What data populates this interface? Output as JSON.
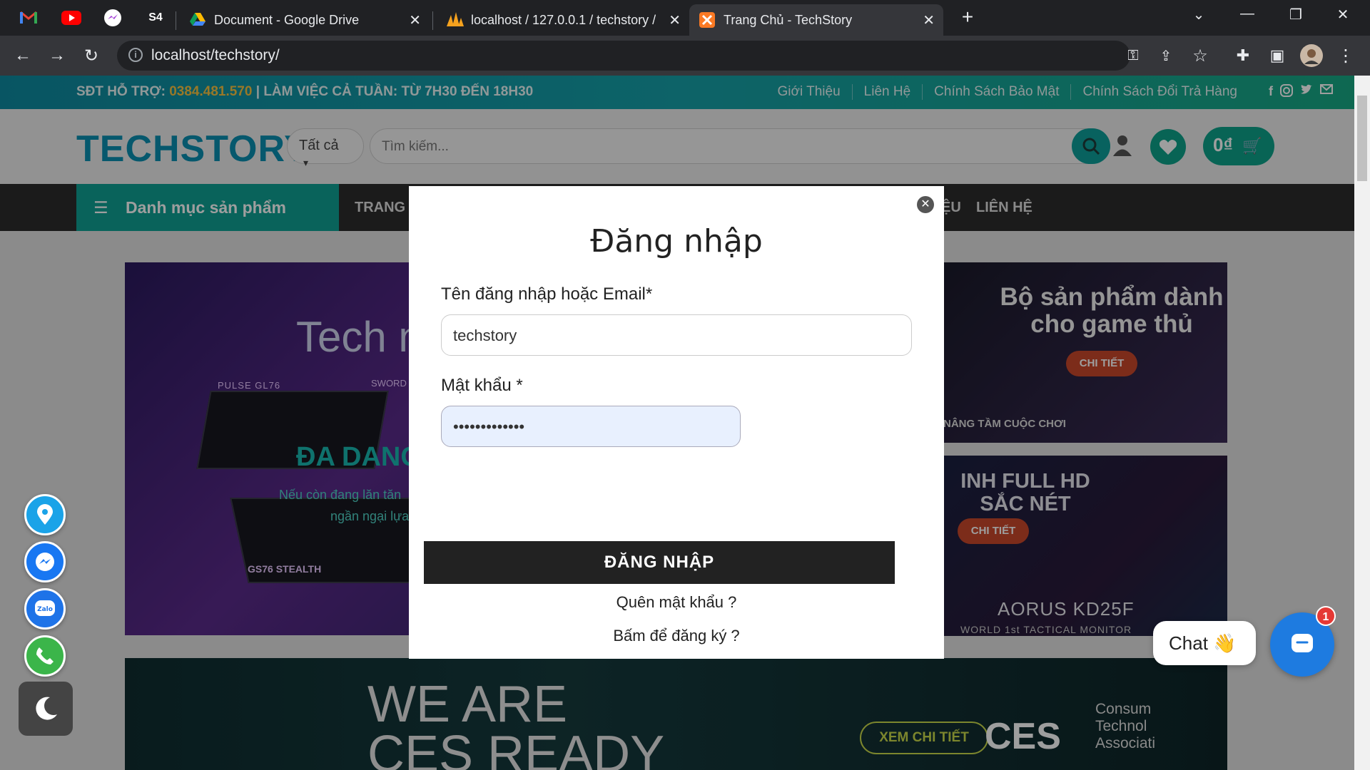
{
  "browser": {
    "pinned_tabs": [
      "gmail-icon",
      "youtube-icon",
      "messenger-icon",
      "s4-icon"
    ],
    "pinned_s4_label": "S4",
    "tabs": [
      {
        "title": "Document - Google Drive"
      },
      {
        "title": "localhost / 127.0.0.1 / techstory /"
      },
      {
        "title": "Trang Chủ - TechStory"
      }
    ],
    "new_tab": "+",
    "url": "localhost/techstory/"
  },
  "topbar": {
    "phone_label": "SĐT HỖ TRỢ:",
    "phone": "0384.481.570",
    "hours": "| LÀM VIỆC CẢ TUẦN: TỪ 7H30 ĐẾN 18H30",
    "links": [
      "Giới Thiệu",
      "Liên Hệ",
      "Chính Sách Bảo Mật",
      "Chính Sách Đổi Trả Hàng"
    ]
  },
  "header": {
    "logo": "TECHSTORY",
    "category_select": "Tất cả",
    "search_placeholder": "Tìm kiếm...",
    "cart_total": "0₫"
  },
  "nav": {
    "category_menu": "Danh mục sản phẩm",
    "link_home": "TRANG C",
    "link_partial": "ỆU",
    "link_contact": "LIÊN HỆ"
  },
  "banners": {
    "main_title": "Tech n",
    "main_model1": "PULSE GL76",
    "main_model2": "SWORD",
    "main_model3": "GS76 STEALTH",
    "main_heading": "ĐA DANG",
    "main_sub1": "Nếu còn đang lăn tăn",
    "main_sub2": "ngần ngại lựa",
    "r1_title": "Bộ sản phẩm dành cho game thủ",
    "r1_button": "CHI TIẾT",
    "r1_footer": "NÂNG TẦM CUỘC CHƠI",
    "r2_title": "INH FULL HD SẮC NÉT",
    "r2_button": "CHI TIẾT",
    "r2_brand": "AORUS KD25F",
    "r2_tag": "WORLD 1st TACTICAL MONITOR",
    "bottom_line1": "WE ARE",
    "bottom_line2": "CES READY",
    "bottom_button": "XEM CHI TIẾT",
    "bottom_ces": "CES",
    "bottom_assoc": "Consum Technol Associati"
  },
  "login_modal": {
    "title": "Đăng nhập",
    "username_label": "Tên đăng nhập hoặc Email*",
    "username_value": "techstory",
    "password_label": "Mật khẩu *",
    "password_value": "•••••••••••••",
    "submit": "ĐĂNG NHẬP",
    "register_link": "Bấm để đăng ký ?",
    "forgot_link": "Quên mật khẩu ?"
  },
  "chat": {
    "label": "Chat",
    "emoji": "👋",
    "badge": "1"
  },
  "colors": {
    "teal": "#10a093",
    "topbar_phone": "#f5c242",
    "logo": "#0b8fb0",
    "submit": "#222222"
  }
}
